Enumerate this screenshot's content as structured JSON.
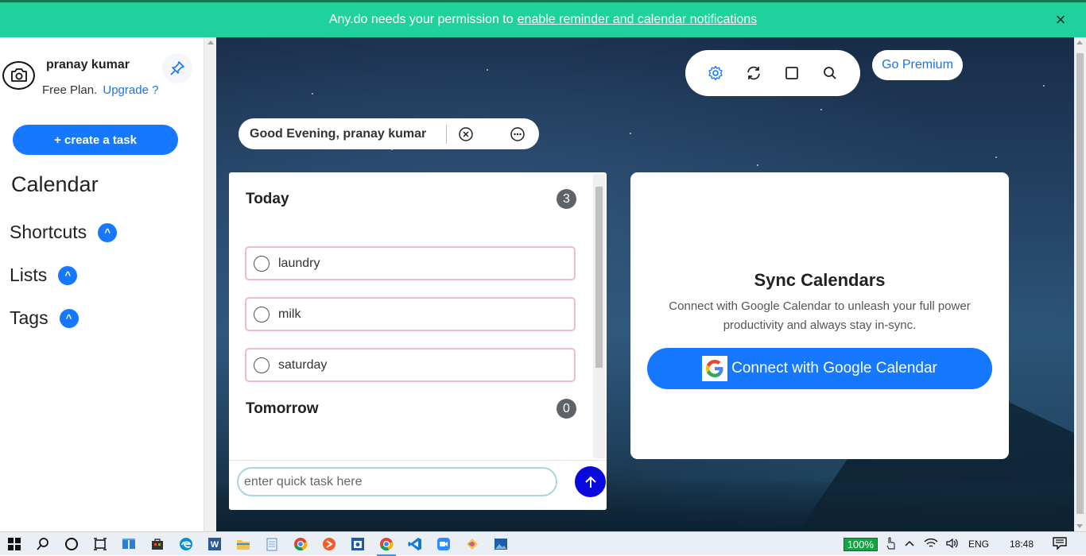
{
  "notification": {
    "text": "Any.do needs your permission to",
    "link": "enable reminder and calendar notifications"
  },
  "user": {
    "name": "pranay kumar",
    "plan": "Free Plan.",
    "upgrade": "Upgrade ?"
  },
  "sidebar": {
    "create_task": "+ create a task",
    "calendar": "Calendar",
    "sections": [
      {
        "label": "Shortcuts",
        "chevron": "^"
      },
      {
        "label": "Lists",
        "chevron": "^"
      },
      {
        "label": "Tags",
        "chevron": "^"
      }
    ]
  },
  "toolbar": {
    "icons": [
      "gear-icon",
      "sync-icon",
      "square-icon",
      "search-icon"
    ],
    "premium": "Go Premium"
  },
  "greeting": {
    "text": "Good Evening, pranay kumar"
  },
  "tasks": {
    "today": {
      "label": "Today",
      "count": "3",
      "items": [
        "laundry",
        "milk",
        "saturday"
      ]
    },
    "tomorrow": {
      "label": "Tomorrow",
      "count": "0"
    },
    "quick_placeholder": "enter quick task here"
  },
  "sync": {
    "title": "Sync Calendars",
    "desc": "Connect with Google Calendar to unleash your full power productivity and always stay in-sync.",
    "button": "Connect with Google Calendar"
  },
  "taskbar": {
    "zoom": "100%",
    "lang": "ENG",
    "time": "18:48"
  }
}
